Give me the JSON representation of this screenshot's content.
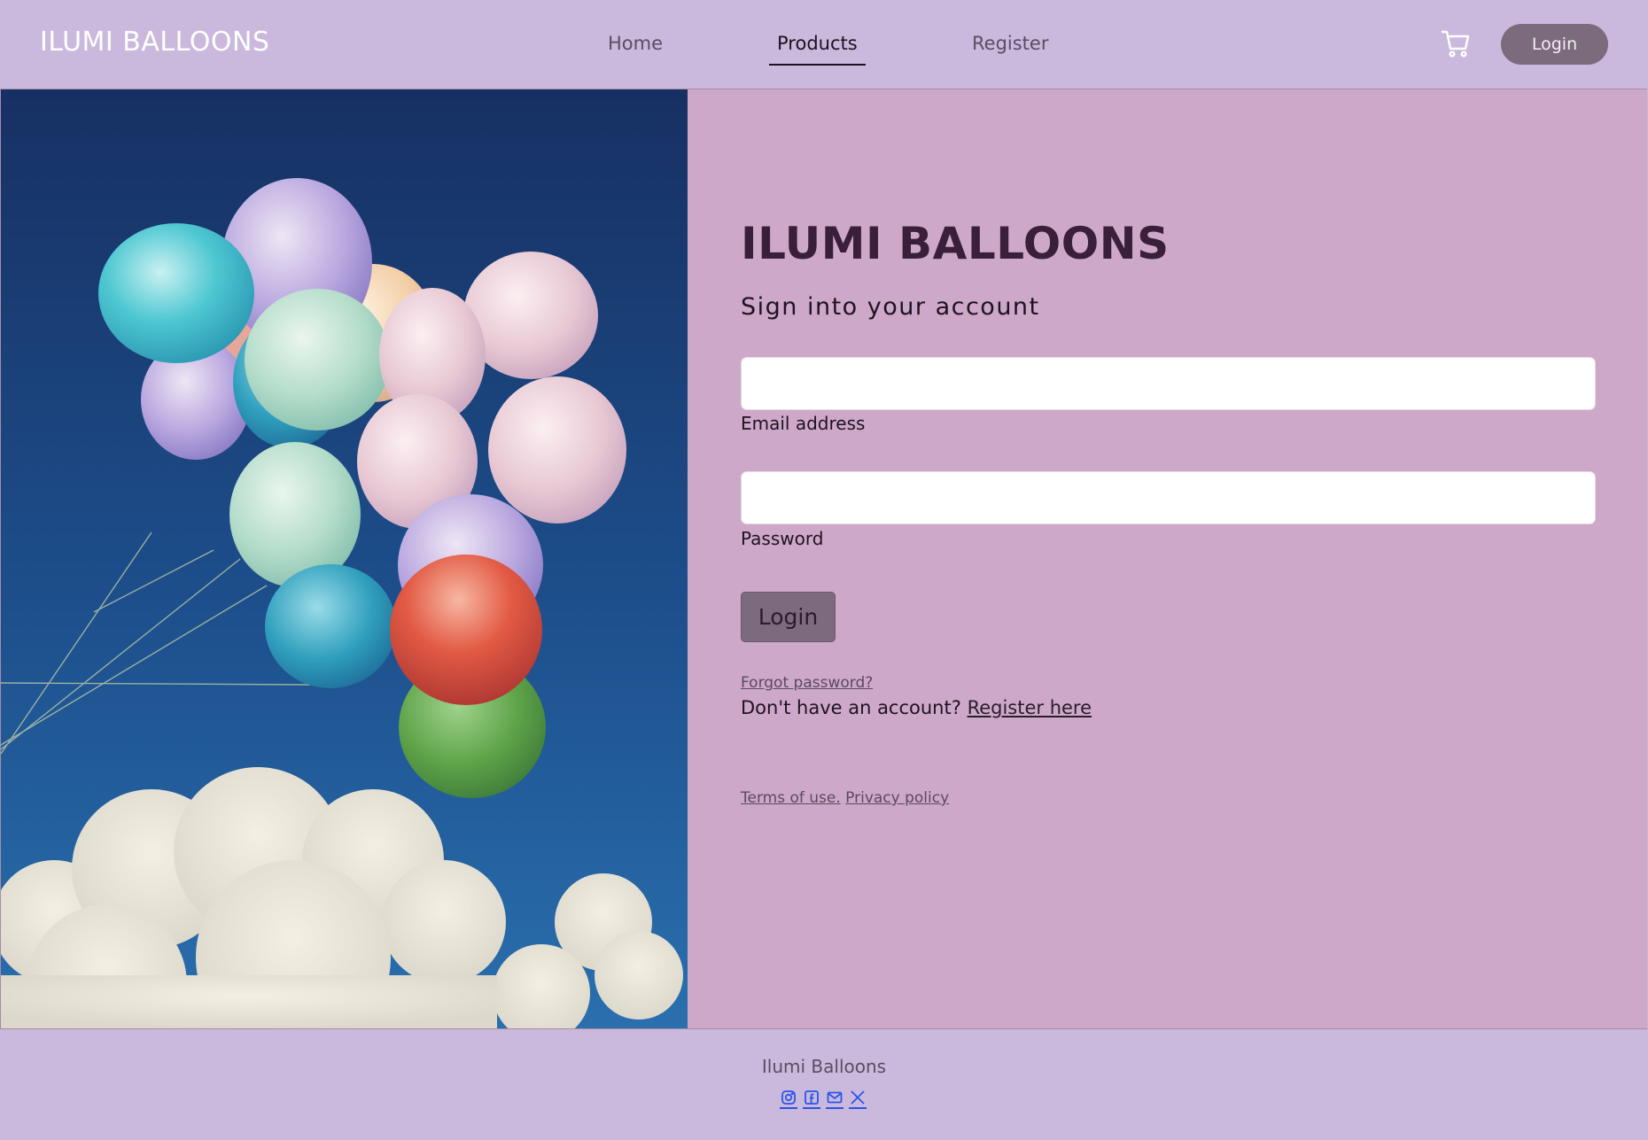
{
  "header": {
    "brand": "ILUMI BALLOONS",
    "nav": [
      {
        "label": "Home"
      },
      {
        "label": "Products"
      },
      {
        "label": "Register"
      }
    ],
    "active_nav": "Products",
    "cart_icon": "cart-icon",
    "login_label": "Login"
  },
  "login": {
    "title": "ILUMI BALLOONS",
    "subtitle": "Sign into your account",
    "email": {
      "label": "Email address",
      "value": "",
      "placeholder": ""
    },
    "password": {
      "label": "Password",
      "value": "",
      "placeholder": ""
    },
    "submit_label": "Login",
    "forgot_label": "Forgot password?",
    "no_account_text": "Don't have an account?",
    "register_link": "Register here",
    "terms_label": "Terms of use.",
    "privacy_label": "Privacy policy"
  },
  "footer": {
    "name": "Ilumi Balloons",
    "social": [
      "instagram-icon",
      "facebook-icon",
      "mail-icon",
      "x-icon"
    ]
  },
  "colors": {
    "nav_bg": "#cab9dc",
    "panel_bg": "#cea8c8",
    "button": "#7b6b7c",
    "title": "#3a1f3a",
    "social_link": "#2a55e8"
  }
}
